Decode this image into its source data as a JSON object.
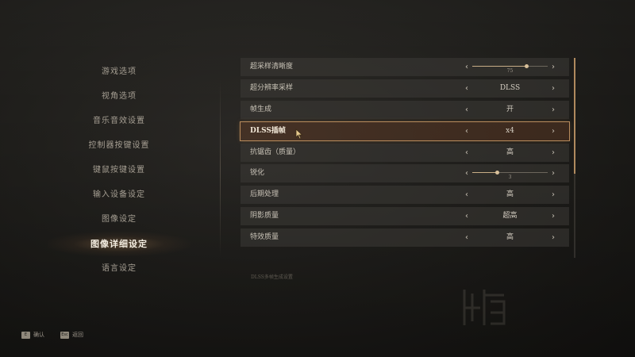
{
  "menu": {
    "items": [
      {
        "label": "游戏选项",
        "active": false
      },
      {
        "label": "视角选项",
        "active": false
      },
      {
        "label": "音乐音效设置",
        "active": false
      },
      {
        "label": "控制器按键设置",
        "active": false
      },
      {
        "label": "键鼠按键设置",
        "active": false
      },
      {
        "label": "输入设备设定",
        "active": false
      },
      {
        "label": "图像设定",
        "active": false
      },
      {
        "label": "图像详细设定",
        "active": true
      },
      {
        "label": "语言设定",
        "active": false
      }
    ]
  },
  "settings": {
    "rows": [
      {
        "label": "超采样清晰度",
        "type": "slider",
        "value": "75",
        "fraction": 0.72
      },
      {
        "label": "超分辨率采样",
        "type": "select",
        "value": "DLSS"
      },
      {
        "label": "帧生成",
        "type": "select",
        "value": "开"
      },
      {
        "label": "DLSS插帧",
        "type": "select",
        "value": "x4",
        "selected": true
      },
      {
        "label": "抗锯齿（质量）",
        "type": "select",
        "value": "高"
      },
      {
        "label": "锐化",
        "type": "slider",
        "value": "3",
        "fraction": 0.33
      },
      {
        "label": "后期处理",
        "type": "select",
        "value": "高"
      },
      {
        "label": "阴影质量",
        "type": "select",
        "value": "超高"
      },
      {
        "label": "特效质量",
        "type": "select",
        "value": "高"
      }
    ],
    "scroll_fraction": 0.58
  },
  "hint_text": "DLSS多帧生成设置",
  "footer": {
    "confirm": {
      "key": "E",
      "label": "确认"
    },
    "back": {
      "key": "Esc",
      "label": "返回"
    }
  },
  "colors": {
    "accent": "#b88b5c",
    "background": "#1b1a18",
    "row": "#3c3a36"
  },
  "icons": {
    "arrow_left": "chevron-left-icon",
    "arrow_right": "chevron-right-icon",
    "cursor": "mouse-pointer-icon"
  }
}
